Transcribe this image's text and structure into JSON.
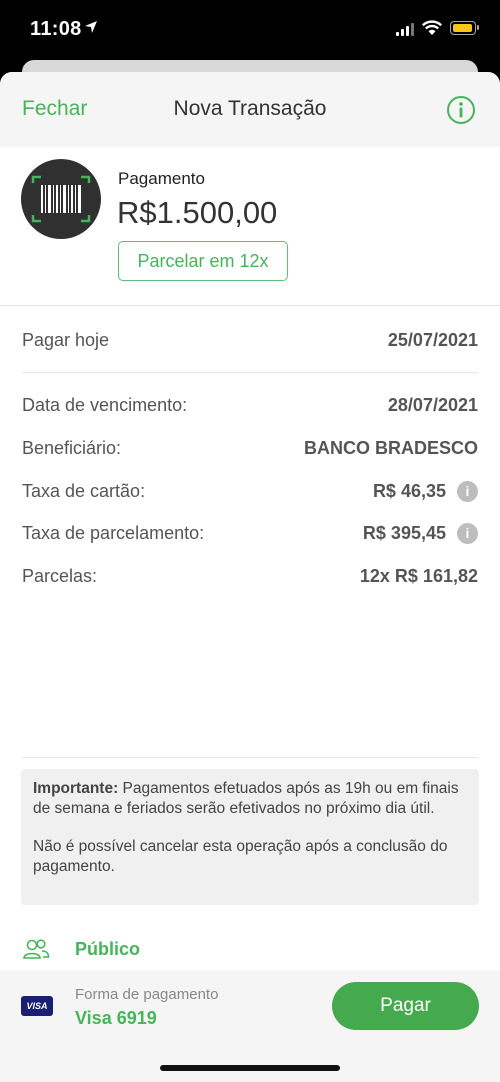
{
  "status_bar": {
    "time": "11:08"
  },
  "nav": {
    "close_label": "Fechar",
    "title": "Nova Transação",
    "info_icon": "info-circle-icon"
  },
  "payment": {
    "type": "Pagamento",
    "amount": "R$1.500,00",
    "installment_button": "Parcelar em 12x"
  },
  "details": {
    "pay_today": {
      "label": "Pagar hoje",
      "value": "25/07/2021"
    },
    "due_date": {
      "label": "Data de vencimento:",
      "value": "28/07/2021"
    },
    "beneficiary": {
      "label": "Beneficiário:",
      "value": "BANCO BRADESCO"
    },
    "card_fee": {
      "label": "Taxa de cartão:",
      "value": "R$ 46,35"
    },
    "installment_fee": {
      "label": "Taxa de parcelamento:",
      "value": "R$ 395,45"
    },
    "installments": {
      "label": "Parcelas:",
      "value": "12x R$ 161,82"
    }
  },
  "notice": {
    "bold": "Importante:",
    "text1": " Pagamentos efetuados após as 19h ou em finais de semana e feriados serão efetivados no próximo dia útil.",
    "text2": "Não é possível cancelar esta operação após a conclusão do pagamento."
  },
  "privacy": {
    "label": "Público"
  },
  "footer": {
    "payment_method_label": "Forma de pagamento",
    "payment_method_value": "Visa 6919",
    "card_brand": "VISA",
    "pay_button": "Pagar"
  },
  "colors": {
    "accent": "#46b45a",
    "button": "#45a94d",
    "visa": "#1a1f71"
  }
}
